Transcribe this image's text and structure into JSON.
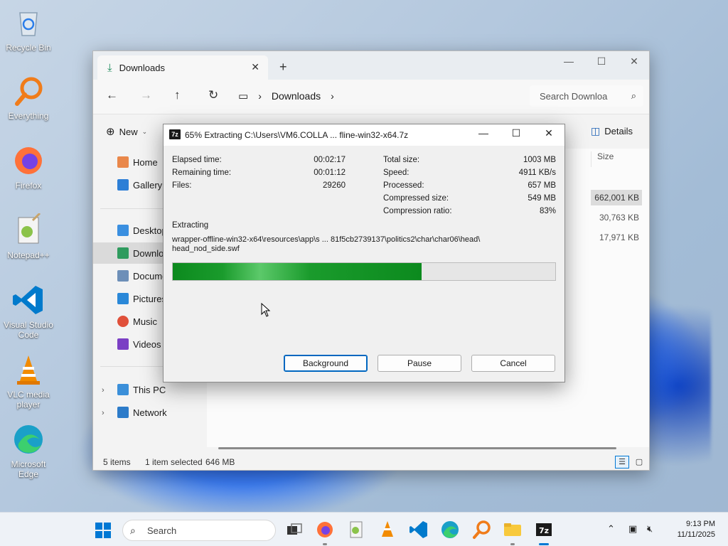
{
  "desktop": {
    "icons": [
      {
        "label": "Recycle Bin"
      },
      {
        "label": "Everything"
      },
      {
        "label": "Firefox"
      },
      {
        "label": "Notepad++"
      },
      {
        "label": "Visual Studio Code"
      },
      {
        "label": "VLC media player"
      },
      {
        "label": "Microsoft Edge"
      }
    ]
  },
  "explorer": {
    "tab_title": "Downloads",
    "breadcrumb": [
      "Downloads"
    ],
    "search_placeholder": "Search Downloa",
    "toolbar": {
      "new_label": "New",
      "details_label": "Details"
    },
    "sidebar": [
      {
        "label": "Home"
      },
      {
        "label": "Gallery"
      },
      {
        "label": "Desktop"
      },
      {
        "label": "Downloads"
      },
      {
        "label": "Documents"
      },
      {
        "label": "Pictures"
      },
      {
        "label": "Music"
      },
      {
        "label": "Videos"
      },
      {
        "label": "This PC"
      },
      {
        "label": "Network"
      }
    ],
    "columns": {
      "size": "Size"
    },
    "file_sizes": [
      "662,001 KB",
      "30,763 KB",
      "17,971 KB"
    ],
    "status": {
      "items": "5 items",
      "selected": "1 item selected",
      "selected_size": "646 MB"
    }
  },
  "dialog": {
    "title": "65% Extracting C:\\Users\\VM6.COLLA ... fline-win32-x64.7z",
    "icon_text": "7z",
    "left": {
      "elapsed_label": "Elapsed time:",
      "elapsed_value": "00:02:17",
      "remaining_label": "Remaining time:",
      "remaining_value": "00:01:12",
      "files_label": "Files:",
      "files_value": "29260"
    },
    "right": {
      "total_label": "Total size:",
      "total_value": "1003 MB",
      "speed_label": "Speed:",
      "speed_value": "4911 KB/s",
      "processed_label": "Processed:",
      "processed_value": "657 MB",
      "compressed_label": "Compressed size:",
      "compressed_value": "549 MB",
      "ratio_label": "Compression ratio:",
      "ratio_value": "83%"
    },
    "extracting_label": "Extracting",
    "path_line1": "wrapper-offline-win32-x64\\resources\\app\\s ... 81f5cb2739137\\politics2\\char\\char06\\head\\",
    "path_line2": "head_nod_side.swf",
    "progress": 0.65,
    "buttons": {
      "background": "Background",
      "pause": "Pause",
      "cancel": "Cancel"
    }
  },
  "taskbar": {
    "search_placeholder": "Search",
    "clock_time": "9:13 PM",
    "clock_date": "11/11/2025"
  }
}
